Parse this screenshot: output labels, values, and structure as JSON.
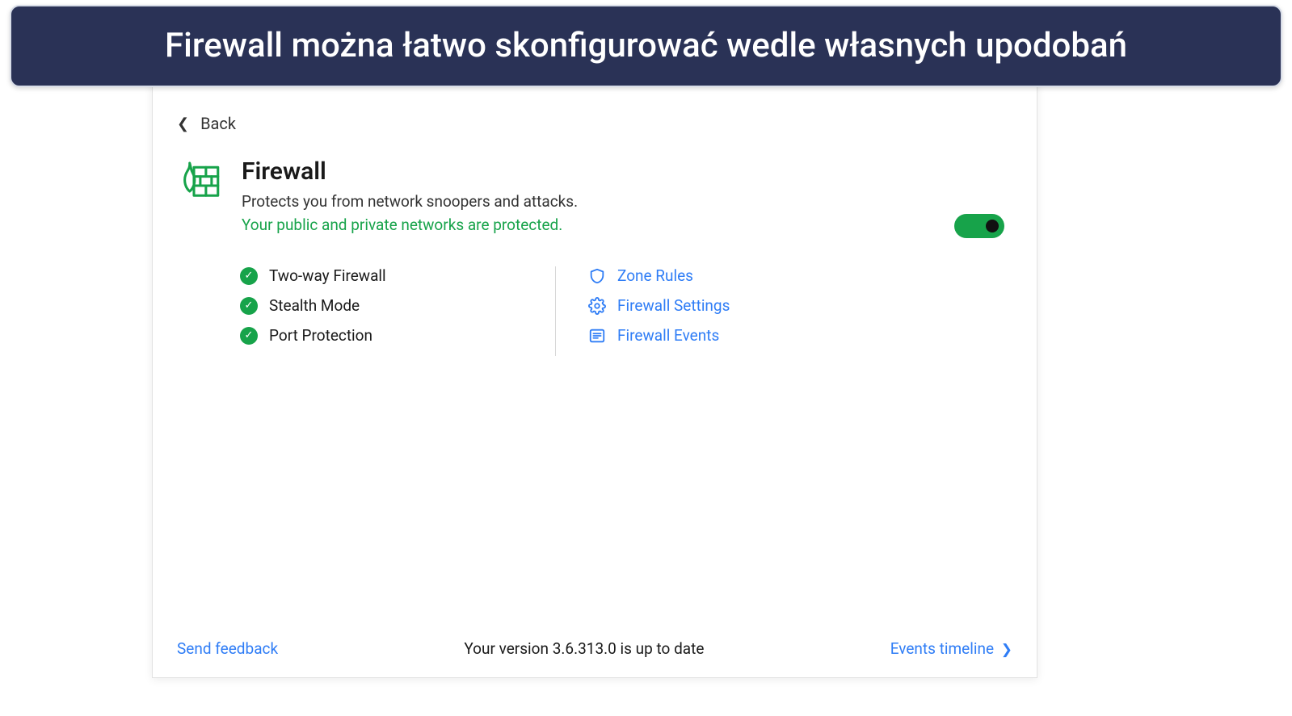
{
  "banner": {
    "text": "Firewall można łatwo skonfigurować wedle własnych upodobań"
  },
  "nav": {
    "back_label": "Back"
  },
  "header": {
    "title": "Firewall",
    "subtitle": "Protects you from network snoopers and attacks.",
    "status": "Your public and private networks are protected."
  },
  "toggle": {
    "enabled": true
  },
  "features": [
    {
      "label": "Two-way Firewall"
    },
    {
      "label": "Stealth Mode"
    },
    {
      "label": "Port Protection"
    }
  ],
  "links": [
    {
      "label": "Zone Rules",
      "icon": "shield-icon"
    },
    {
      "label": "Firewall Settings",
      "icon": "gear-icon"
    },
    {
      "label": "Firewall Events",
      "icon": "list-icon"
    }
  ],
  "footer": {
    "feedback": "Send feedback",
    "version": "Your version 3.6.313.0 is up to date",
    "events": "Events timeline"
  },
  "colors": {
    "accent_green": "#17a34a",
    "link_blue": "#2f7df6",
    "banner_bg": "#2a3256"
  }
}
